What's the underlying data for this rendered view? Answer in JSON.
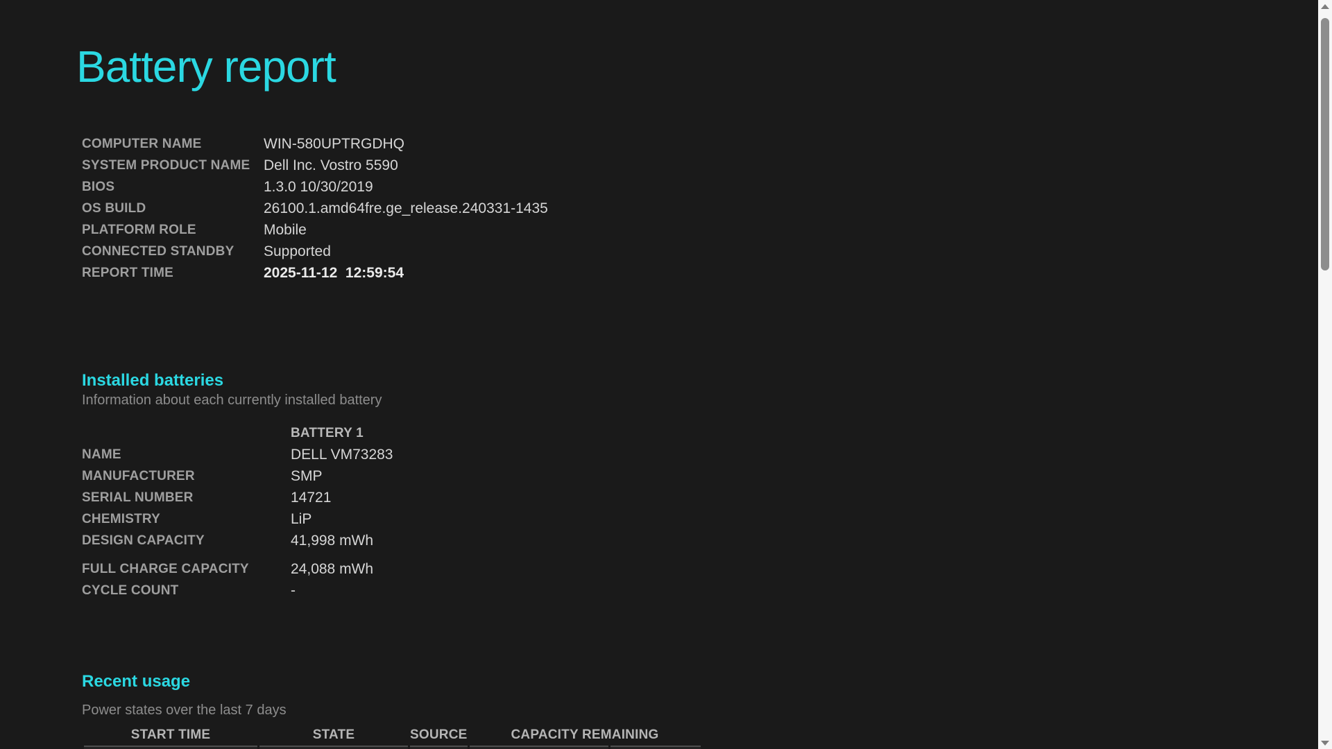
{
  "title": "Battery report",
  "colors": {
    "accent_cyan": "#2bd8e2",
    "page_background": "#1a1a1a",
    "label_gray": "#9f9f9f",
    "value_gray": "#d6d6d6"
  },
  "system_info": {
    "rows": [
      {
        "label": "COMPUTER NAME",
        "value": "WIN-580UPTRGDHQ"
      },
      {
        "label": "SYSTEM PRODUCT NAME",
        "value": "Dell Inc. Vostro 5590"
      },
      {
        "label": "BIOS",
        "value": "1.3.0 10/30/2019"
      },
      {
        "label": "OS BUILD",
        "value": "26100.1.amd64fre.ge_release.240331-1435"
      },
      {
        "label": "PLATFORM ROLE",
        "value": "Mobile"
      },
      {
        "label": "CONNECTED STANDBY",
        "value": "Supported"
      },
      {
        "label": "REPORT TIME",
        "value": "2025-11-12  12:59:54"
      }
    ]
  },
  "installed_batteries": {
    "heading": "Installed batteries",
    "subtitle": "Information about each currently installed battery",
    "column_header": "BATTERY 1",
    "rows": [
      {
        "label": "NAME",
        "value": "DELL VM73283"
      },
      {
        "label": "MANUFACTURER",
        "value": "SMP"
      },
      {
        "label": "SERIAL NUMBER",
        "value": "14721"
      },
      {
        "label": "CHEMISTRY",
        "value": "LiP"
      },
      {
        "label": "DESIGN CAPACITY",
        "value": "41,998 mWh"
      },
      {
        "label": "FULL CHARGE CAPACITY",
        "value": "24,088 mWh"
      },
      {
        "label": "CYCLE COUNT",
        "value": "-"
      }
    ]
  },
  "recent_usage": {
    "heading": "Recent usage",
    "subtitle": "Power states over the last 7 days",
    "columns": [
      "START TIME",
      "STATE",
      "SOURCE",
      "CAPACITY REMAINING"
    ]
  },
  "icons": {
    "scroll_up": "triangle-up",
    "scroll_down": "triangle-down"
  }
}
